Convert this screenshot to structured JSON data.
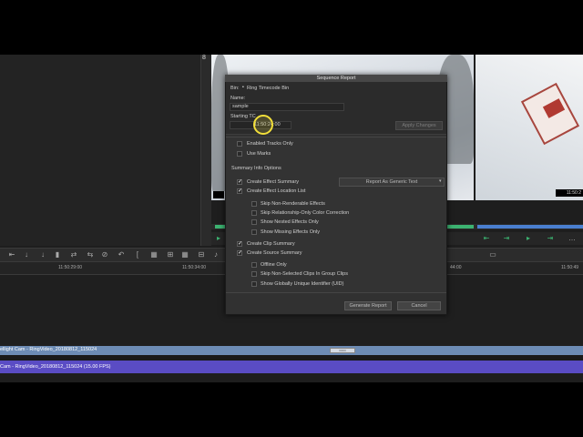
{
  "left_panel": {
    "number": "8"
  },
  "record_monitor": {
    "timecode": "11:50:2"
  },
  "ruler": {
    "ticks": [
      "11:50:29:00",
      "11:50:34:00",
      "44:00",
      "11:50:49"
    ]
  },
  "tracks": {
    "track1_label": "ellight Cam - RingVideo_20180812_115024",
    "track2_label": "Cam - RingVideo_20180812_115024 (15.00 FPS)"
  },
  "dialog": {
    "title": "Sequence Report",
    "bin_label": "Bin:",
    "bin_value": "Ring Timecode Bin",
    "name_label": "Name:",
    "name_value": "sample",
    "starting_tc_label": "Starting TC",
    "starting_tc_value": "11:50:24:00",
    "apply_changes": "Apply Changes",
    "enabled_tracks_only": "Enabled Tracks Only",
    "use_marks": "Use Marks",
    "summary_info_options": "Summary Info Options",
    "create_effect_summary": "Create Effect Summary",
    "report_format": "Report As Generic Text",
    "create_effect_location_list": "Create Effect Location List",
    "skip_non_renderable": "Skip Non-Renderable Effects",
    "skip_relationship": "Skip Relationship-Only Color Correction",
    "show_nested": "Show Nested Effects Only",
    "show_missing": "Show Missing Effects Only",
    "create_clip_summary": "Create Clip Summary",
    "create_source_summary": "Create Source Summary",
    "offline_only": "Offline Only",
    "skip_non_selected": "Skip Non-Selected Clips In Group Clips",
    "show_uid": "Show Globally Unique Identifier (UID)",
    "generate_report": "Generate Report",
    "cancel": "Cancel",
    "checks": {
      "enabled_tracks_only": false,
      "use_marks": false,
      "create_effect_summary": true,
      "create_effect_location_list": true,
      "skip_non_renderable": false,
      "skip_relationship": false,
      "show_nested": false,
      "show_missing": false,
      "create_clip_summary": true,
      "create_source_summary": true,
      "offline_only": false,
      "skip_non_selected": false,
      "show_uid": false
    }
  }
}
